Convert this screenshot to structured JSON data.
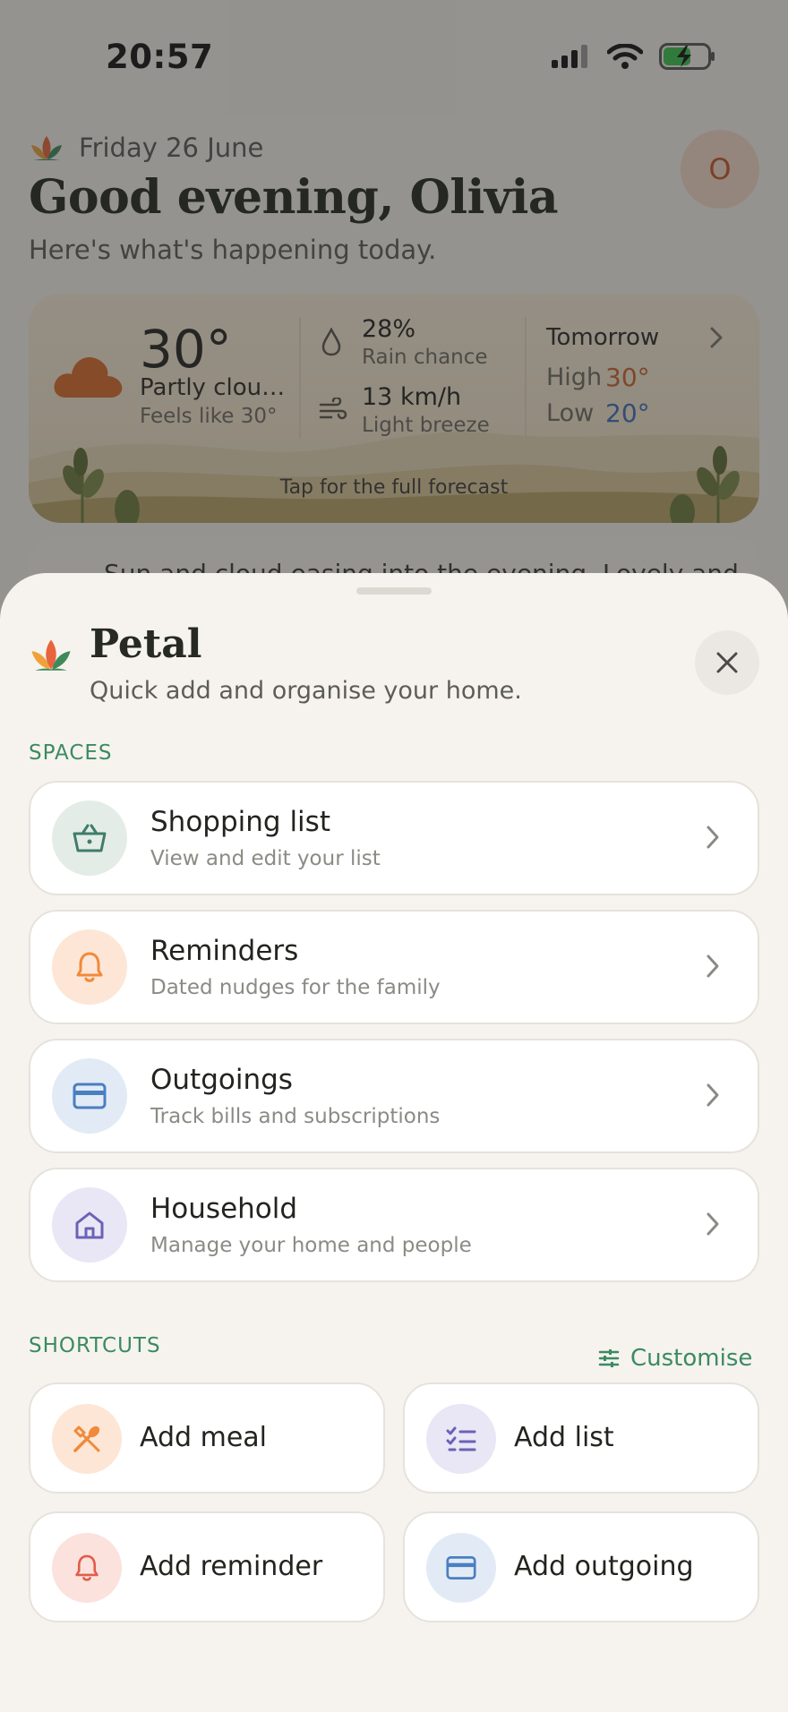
{
  "status_bar": {
    "time": "20:57"
  },
  "background": {
    "date": "Friday 26 June",
    "greeting": "Good evening, Olivia",
    "subtitle": "Here's what's happening today.",
    "avatar_initial": "O",
    "weather": {
      "temperature": "30°",
      "condition": "Partly clou…",
      "feels_like": "Feels like 30°",
      "rain_value": "28%",
      "rain_label": "Rain chance",
      "wind_value": "13 km/h",
      "wind_label": "Light breeze",
      "tomorrow_label": "Tomorrow",
      "high_label": "High",
      "high_value": "30°",
      "low_label": "Low",
      "low_value": "20°",
      "tap_hint": "Tap for the full forecast"
    },
    "summary_peek": "Sun and cloud easing into the evening. Lovely and"
  },
  "sheet": {
    "title": "Petal",
    "subtitle": "Quick add and organise your home.",
    "spaces_label": "SPACES",
    "spaces": [
      {
        "title": "Shopping list",
        "subtitle": "View and edit your list",
        "icon": "basket-icon"
      },
      {
        "title": "Reminders",
        "subtitle": "Dated nudges for the family",
        "icon": "bell-icon"
      },
      {
        "title": "Outgoings",
        "subtitle": "Track bills and subscriptions",
        "icon": "card-icon"
      },
      {
        "title": "Household",
        "subtitle": "Manage your home and people",
        "icon": "home-icon"
      }
    ],
    "shortcuts_label": "SHORTCUTS",
    "customise_label": "Customise",
    "shortcuts": [
      {
        "label": "Add meal",
        "icon": "cutlery-icon"
      },
      {
        "label": "Add list",
        "icon": "checklist-icon"
      },
      {
        "label": "Add reminder",
        "icon": "bell-icon"
      },
      {
        "label": "Add outgoing",
        "icon": "card-icon"
      }
    ]
  },
  "colors": {
    "accent_green": "#3b8a63",
    "orange": "#f08a3a",
    "blue": "#4a7fc1",
    "purple": "#6a62b5",
    "red": "#e25c4a"
  }
}
